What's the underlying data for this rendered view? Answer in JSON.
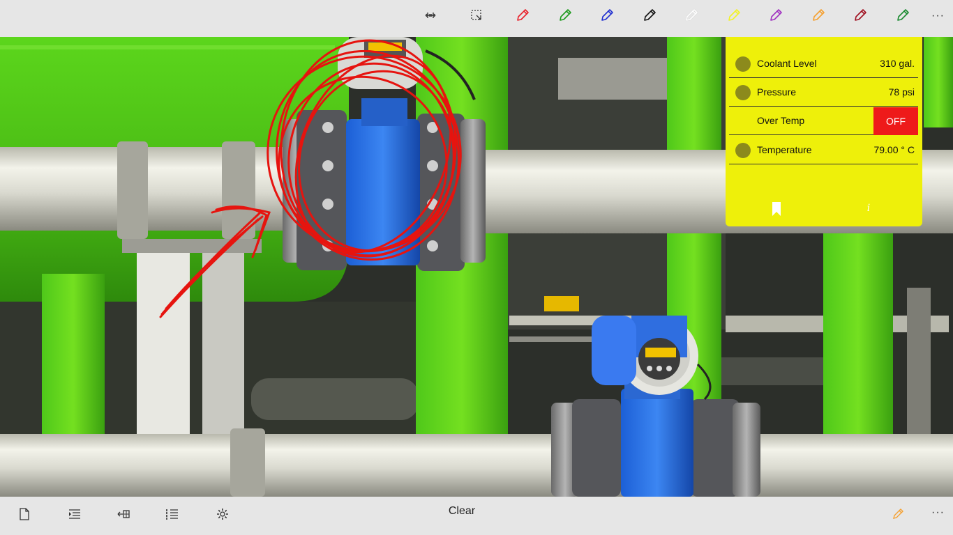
{
  "toolbar": {
    "tools": [
      {
        "name": "ruler-icon"
      },
      {
        "name": "lasso-select-icon"
      }
    ],
    "pens": [
      {
        "name": "red-pen",
        "color": "#e8202a"
      },
      {
        "name": "green-pen",
        "color": "#1e9a1e"
      },
      {
        "name": "blue-pen",
        "color": "#2030d0"
      },
      {
        "name": "black-pen",
        "color": "#111111"
      },
      {
        "name": "white-pen",
        "color": "#ffffff"
      },
      {
        "name": "yellow-pen",
        "color": "#f2f226"
      },
      {
        "name": "purple-pen",
        "color": "#a030c0"
      },
      {
        "name": "orange-pen",
        "color": "#f5a030"
      },
      {
        "name": "dark-red-pen",
        "color": "#a01020"
      },
      {
        "name": "dark-green-pen",
        "color": "#1a8a30"
      }
    ],
    "more_label": "···"
  },
  "panel": {
    "background": "#eef00a",
    "rows": [
      {
        "label": "Coolant Level",
        "value": "310 gal.",
        "indicator": "#8c8a1c"
      },
      {
        "label": "Pressure",
        "value": "78 psi",
        "indicator": "#8c8a1c"
      },
      {
        "label": "Over Temp",
        "toggle_label": "OFF",
        "toggle_color": "#ee1a1a"
      },
      {
        "label": "Temperature",
        "value": "79.00 ° C",
        "indicator": "#8c8a1c"
      }
    ],
    "info_label": "i"
  },
  "bottombar": {
    "clear_label": "Clear",
    "more_label": "···",
    "active_pen_color": "#f5a030"
  }
}
